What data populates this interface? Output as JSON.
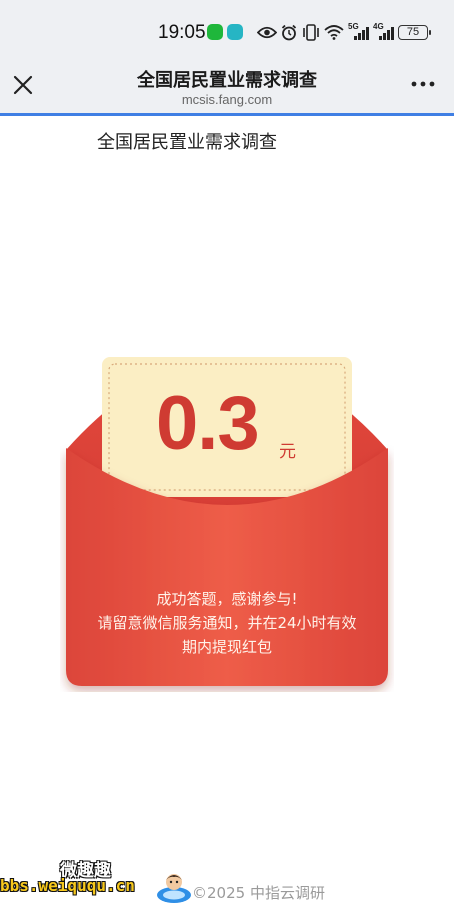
{
  "status_bar": {
    "time": "19:05",
    "battery": "75",
    "icons": [
      "wechat-icon",
      "message-icon",
      "eye-icon",
      "alarm-icon",
      "vibrate-icon",
      "wifi-icon",
      "signal-5g-icon",
      "signal-4g-icon"
    ],
    "net_5g": "5G",
    "net_4g": "4G"
  },
  "nav": {
    "title": "全国居民置业需求调查",
    "url": "mcsis.fang.com",
    "close_icon": "close-icon",
    "more_icon": "more-icon"
  },
  "page": {
    "title": "全国居民置业需求调查"
  },
  "red_packet": {
    "amount": "0.3",
    "unit": "元",
    "message_line1": "成功答题，感谢参与!",
    "message_line2": "请留意微信服务通知，并在24小时有效",
    "message_line3": "期内提现红包",
    "colors": {
      "envelope": "#e2473a",
      "flap": "#ee5a45",
      "card": "#fbeec4",
      "amount": "#cf3b32"
    }
  },
  "footer": {
    "copyright": "©2025 中指云调研"
  },
  "watermark": {
    "name": "微趣趣",
    "site": "bbs.weiququ.cn"
  },
  "colors": {
    "accent": "#3f7fe4",
    "nav_bg": "#eef0f3"
  }
}
